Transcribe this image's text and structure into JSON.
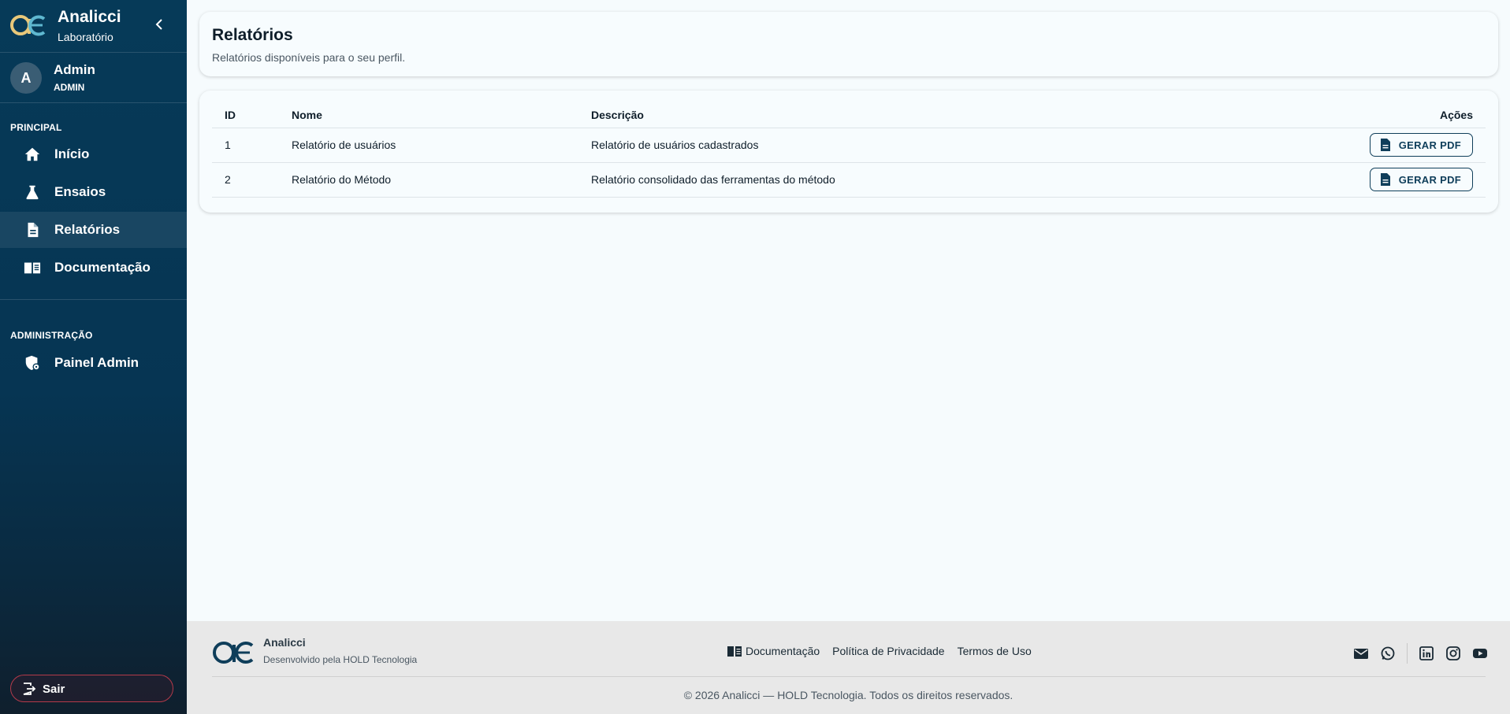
{
  "colors": {
    "sidebar": "#063a58",
    "accent": "#0f3e5a",
    "logout_border": "#b33a4a",
    "logo_gold": "#e8c87a",
    "logo_teal": "#5fb8d0"
  },
  "brand": {
    "name": "Analicci",
    "subtitle": "Laboratório",
    "logo_icon": "analicci-logo"
  },
  "user": {
    "initial": "A",
    "name": "Admin",
    "role": "ADMIN"
  },
  "sidebar": {
    "section_principal": "PRINCIPAL",
    "items": [
      {
        "label": "Início",
        "icon": "home-icon"
      },
      {
        "label": "Ensaios",
        "icon": "flask-icon"
      },
      {
        "label": "Relatórios",
        "icon": "document-icon",
        "active": true
      },
      {
        "label": "Documentação",
        "icon": "book-icon"
      }
    ],
    "section_admin": "ADMINISTRAÇÃO",
    "admin_items": [
      {
        "label": "Painel Admin",
        "icon": "admin-shield-icon"
      }
    ],
    "logout_label": "Sair"
  },
  "page": {
    "title": "Relatórios",
    "subtitle": "Relatórios disponíveis para o seu perfil."
  },
  "table": {
    "headers": {
      "id": "ID",
      "nome": "Nome",
      "descricao": "Descrição",
      "acoes": "Ações"
    },
    "rows": [
      {
        "id": "1",
        "nome": "Relatório de usuários",
        "descricao": "Relatório de usuários cadastrados",
        "action": "GERAR PDF"
      },
      {
        "id": "2",
        "nome": "Relatório do Método",
        "descricao": "Relatório consolidado das ferramentas do método",
        "action": "GERAR PDF"
      }
    ]
  },
  "footer": {
    "name": "Analicci",
    "developer": "Desenvolvido pela HOLD Tecnologia",
    "links": [
      "Documentação",
      "Política de Privacidade",
      "Termos de Uso"
    ],
    "social": [
      "email-icon",
      "whatsapp-icon",
      "linkedin-icon",
      "instagram-icon",
      "youtube-icon"
    ],
    "copyright": "© 2026 Analicci — HOLD Tecnologia. Todos os direitos reservados."
  }
}
